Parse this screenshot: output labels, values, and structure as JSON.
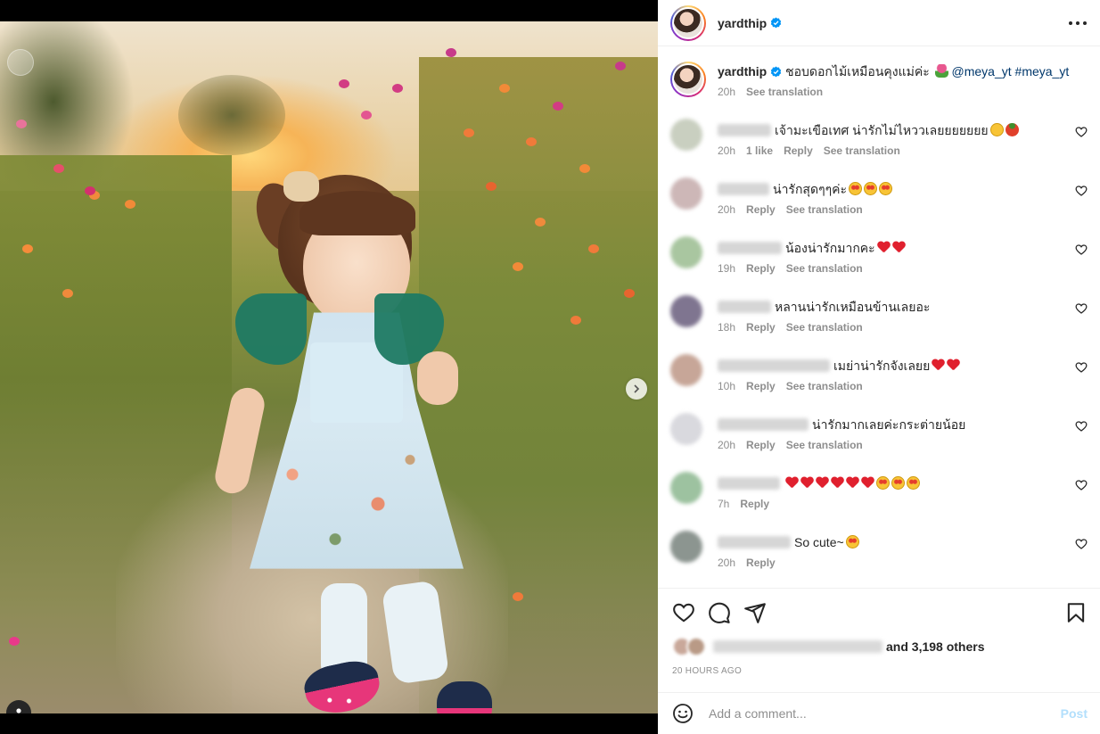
{
  "post": {
    "username": "yardthip",
    "caption": "ชอบดอกไม้เหมือนคุงแม่ค่ะ",
    "mention": "@meya_yt",
    "hashtag": "#meya_yt",
    "caption_time": "20h",
    "see_translation": "See translation"
  },
  "media": {
    "slide_count": 3,
    "active_slide": 1
  },
  "comments": [
    {
      "text": "เจ้ามะเขือเทศ น่ารักไม่ไหววเลยยยยยยย",
      "emojis": [
        "smile",
        "tomato"
      ],
      "time": "20h",
      "likes": "1 like",
      "reply": "Reply",
      "translate": "See translation",
      "avatar": "#c9cfc0",
      "name_w": 60
    },
    {
      "text": "น่ารักสุดๆๆค่ะ",
      "emojis": [
        "star",
        "star",
        "star"
      ],
      "time": "20h",
      "reply": "Reply",
      "translate": "See translation",
      "avatar": "#cdb7b7",
      "name_w": 58
    },
    {
      "text": "น้องน่ารักมากคะ",
      "emojis": [
        "heart",
        "heart"
      ],
      "time": "19h",
      "reply": "Reply",
      "translate": "See translation",
      "avatar": "#a9c6a0",
      "name_w": 72
    },
    {
      "text": "หลานน่ารักเหมือนข้านเลยอะ",
      "emojis": [],
      "time": "18h",
      "reply": "Reply",
      "translate": "See translation",
      "avatar": "#7f7590",
      "name_w": 60
    },
    {
      "text": "เมย่าน่ารักจังเลยย",
      "emojis": [
        "heart",
        "heart"
      ],
      "time": "10h",
      "reply": "Reply",
      "translate": "See translation",
      "avatar": "#c7a698",
      "name_w": 126
    },
    {
      "text": "น่ารักมากเลยค่ะกระต่ายน้อย",
      "emojis": [],
      "time": "20h",
      "reply": "Reply",
      "translate": "See translation",
      "avatar": "#d9d9de",
      "name_w": 102
    },
    {
      "text": "",
      "emojis": [
        "heart",
        "heart",
        "heart",
        "heart",
        "heart",
        "heart",
        "star",
        "star",
        "star"
      ],
      "time": "7h",
      "reply": "Reply",
      "translate": "",
      "avatar": "#9dc2a0",
      "name_w": 70
    },
    {
      "text": "So cute~",
      "emojis": [
        "star"
      ],
      "time": "20h",
      "reply": "Reply",
      "translate": "",
      "avatar": "#8c9590",
      "name_w": 82
    }
  ],
  "likes": {
    "others_text": "and 3,198 others"
  },
  "timestamp": "20 hours ago",
  "composer": {
    "placeholder": "Add a comment...",
    "post_label": "Post"
  },
  "colors": {
    "link": "#00376b",
    "verified": "#0095f6",
    "post_disabled": "#b2dffc",
    "muted": "#8e8e8e"
  }
}
